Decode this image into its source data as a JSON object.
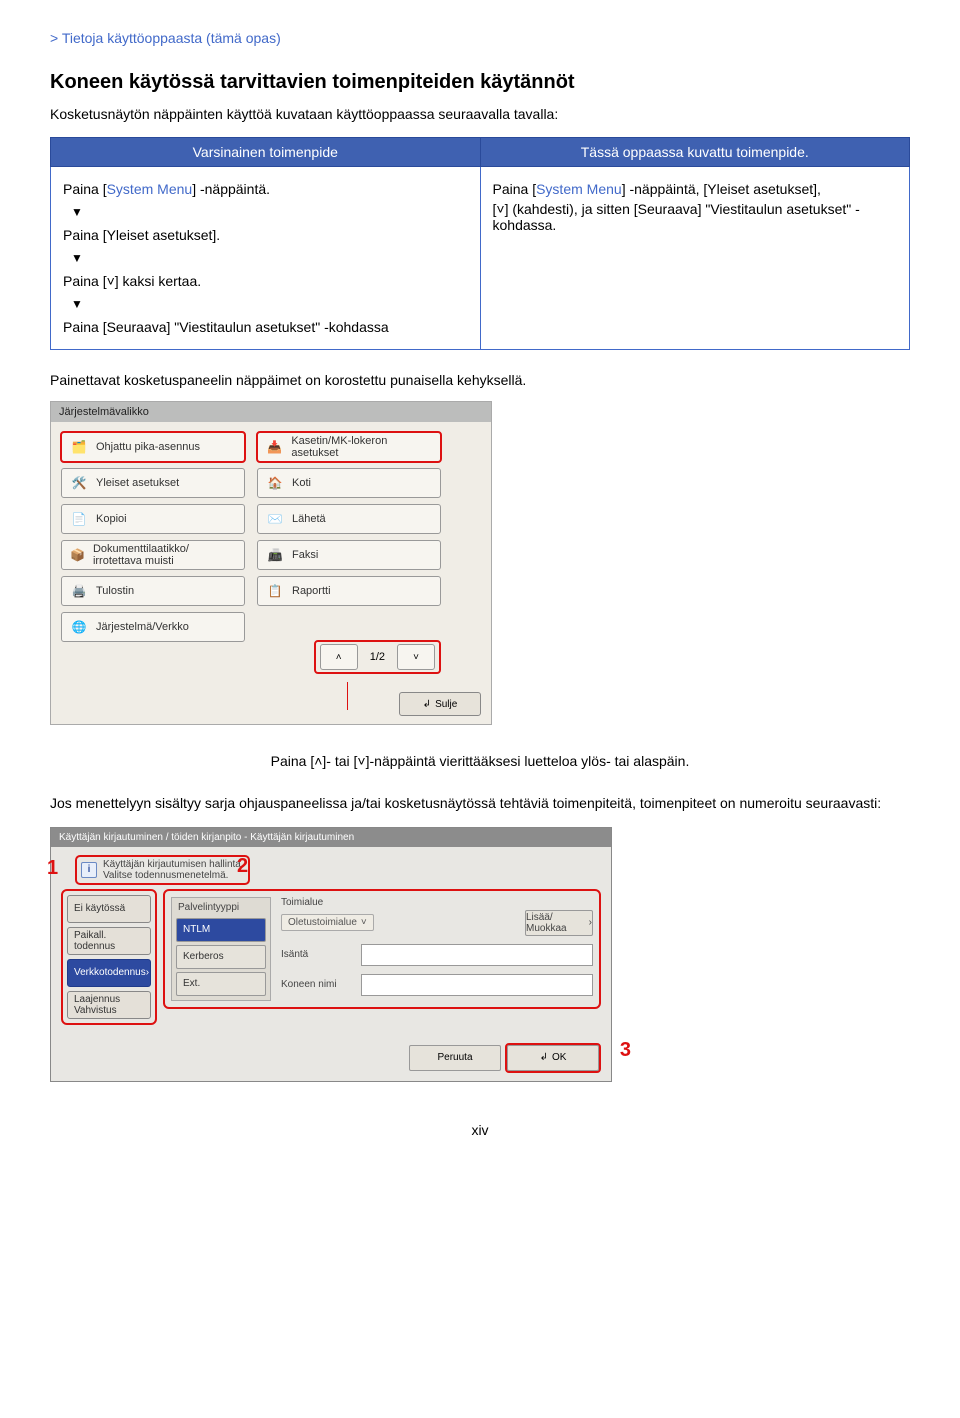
{
  "breadcrumb": "> Tietoja käyttöoppaasta (tämä opas)",
  "section_title": "Koneen käytössä tarvittavien toimenpiteiden käytännöt",
  "intro": "Kosketusnäytön näppäinten käyttöä kuvataan käyttöoppaassa seuraavalla tavalla:",
  "table": {
    "headers": {
      "left": "Varsinainen toimenpide",
      "right": "Tässä oppaassa kuvattu toimenpide."
    },
    "left_steps": {
      "s1_pre": "Paina [",
      "s1_blue": "System Menu",
      "s1_post": "] -näppäintä.",
      "s2": "Paina [Yleiset asetukset].",
      "s3_pre": "Paina [",
      "s3_icon": "˅",
      "s3_post": "] kaksi kertaa.",
      "s4": "Paina [Seuraava] \"Viestitaulun asetukset\" -kohdassa"
    },
    "right": {
      "l1_pre": "Paina [",
      "l1_blue": "System Menu",
      "l1_post": "] -näppäintä, [Yleiset asetukset],",
      "l2_pre": "[",
      "l2_icon": "˅",
      "l2_post": "] (kahdesti), ja sitten [Seuraava] \"Viestitaulun asetukset\" -kohdassa."
    },
    "arrow": "▼"
  },
  "panel_caption": "Painettavat kosketuspaneelin näppäimet on korostettu punaisella kehyksellä.",
  "screenshot1": {
    "title": "Järjestelmävalikko",
    "left": [
      "Ohjattu pika-asennus",
      "Yleiset asetukset",
      "Kopioi",
      "Dokumenttilaatikko/ irrotettava muisti",
      "Tulostin",
      "Järjestelmä/Verkko"
    ],
    "right": [
      "Kasetin/MK-lokeron asetukset",
      "Koti",
      "Lähetä",
      "Faksi",
      "Raportti"
    ],
    "pager_label": "1/2",
    "close": "Sulje"
  },
  "pager_note": {
    "pre": "Paina [",
    "up": "˄",
    "mid": "]- tai [",
    "down": "˅",
    "post": "]-näppäintä vierittääksesi luetteloa ylös- tai alaspäin."
  },
  "block2": "Jos menettelyyn sisältyy sarja ohjauspaneelissa ja/tai kosketusnäytössä tehtäviä toimenpiteitä, toimenpiteet on numeroitu seuraavasti:",
  "screenshot2": {
    "title": "Käyttäjän kirjautuminen / töiden kirjanpito - Käyttäjän kirjautuminen",
    "info_line1": "Käyttäjän kirjautumisen hallinta.",
    "info_line2": "Valitse todennusmenetelmä.",
    "tabs": [
      "Ei käytössä",
      "Paikall. todennus",
      "Verkkotodennus",
      "Laajennus Vahvistus"
    ],
    "active_tab_index": 2,
    "server": {
      "title": "Palvelintyyppi",
      "options": [
        "NTLM",
        "Kerberos",
        "Ext."
      ],
      "active_index": 0
    },
    "fields": {
      "domain_label": "Toimialue",
      "domain_pill": "Oletustoimialue",
      "edit_btn": "Lisää/ Muokkaa",
      "host_label": "Isäntä",
      "name_label": "Koneen nimi"
    },
    "footer": {
      "cancel": "Peruuta",
      "ok": "OK"
    },
    "numbers": {
      "one": "1",
      "two": "2",
      "three": "3"
    }
  },
  "page_number": "xiv"
}
